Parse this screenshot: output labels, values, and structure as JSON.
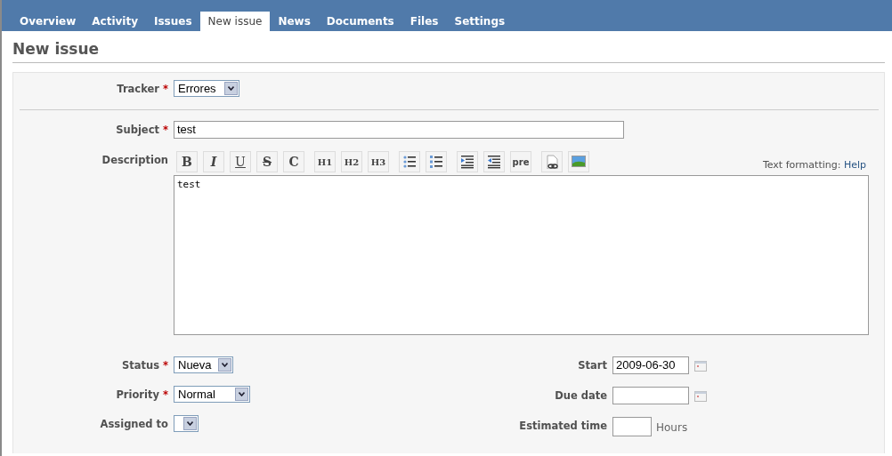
{
  "tabs": [
    {
      "label": "Overview",
      "selected": false
    },
    {
      "label": "Activity",
      "selected": false
    },
    {
      "label": "Issues",
      "selected": false
    },
    {
      "label": "New issue",
      "selected": true
    },
    {
      "label": "News",
      "selected": false
    },
    {
      "label": "Documents",
      "selected": false
    },
    {
      "label": "Files",
      "selected": false
    },
    {
      "label": "Settings",
      "selected": false
    }
  ],
  "heading": "New issue",
  "form": {
    "tracker": {
      "label": "Tracker",
      "required_mark": "*",
      "value": "Errores"
    },
    "subject": {
      "label": "Subject",
      "required_mark": "*",
      "value": "test"
    },
    "description": {
      "label": "Description",
      "toolbar": [
        [
          {
            "kind": "bold",
            "text": "B"
          },
          {
            "kind": "italic",
            "text": "I"
          },
          {
            "kind": "underline",
            "text": "U"
          },
          {
            "kind": "strike",
            "text": "S"
          },
          {
            "kind": "code",
            "text": "C"
          }
        ],
        [
          {
            "kind": "heading",
            "text": "H1"
          },
          {
            "kind": "heading",
            "text": "H2"
          },
          {
            "kind": "heading",
            "text": "H3"
          }
        ],
        [
          {
            "kind": "bullet-list"
          },
          {
            "kind": "numbered-list"
          }
        ],
        [
          {
            "kind": "indent"
          },
          {
            "kind": "outdent"
          },
          {
            "kind": "pre",
            "text": "pre"
          }
        ],
        [
          {
            "kind": "link"
          },
          {
            "kind": "image"
          }
        ]
      ],
      "help_label": "Text formatting:",
      "help_link": "Help",
      "value": "test"
    },
    "left_fields": [
      {
        "kind": "select",
        "label": "Status",
        "required_mark": "*",
        "value": "Nueva"
      },
      {
        "kind": "select",
        "label": "Priority",
        "required_mark": "*",
        "value": "Normal"
      },
      {
        "kind": "select",
        "label": "Assigned to"
      }
    ],
    "right_fields": [
      {
        "kind": "date",
        "label": "Start",
        "value": "2009-06-30"
      },
      {
        "kind": "date",
        "label": "Due date"
      },
      {
        "kind": "number",
        "label": "Estimated time",
        "unit": "Hours"
      }
    ]
  }
}
